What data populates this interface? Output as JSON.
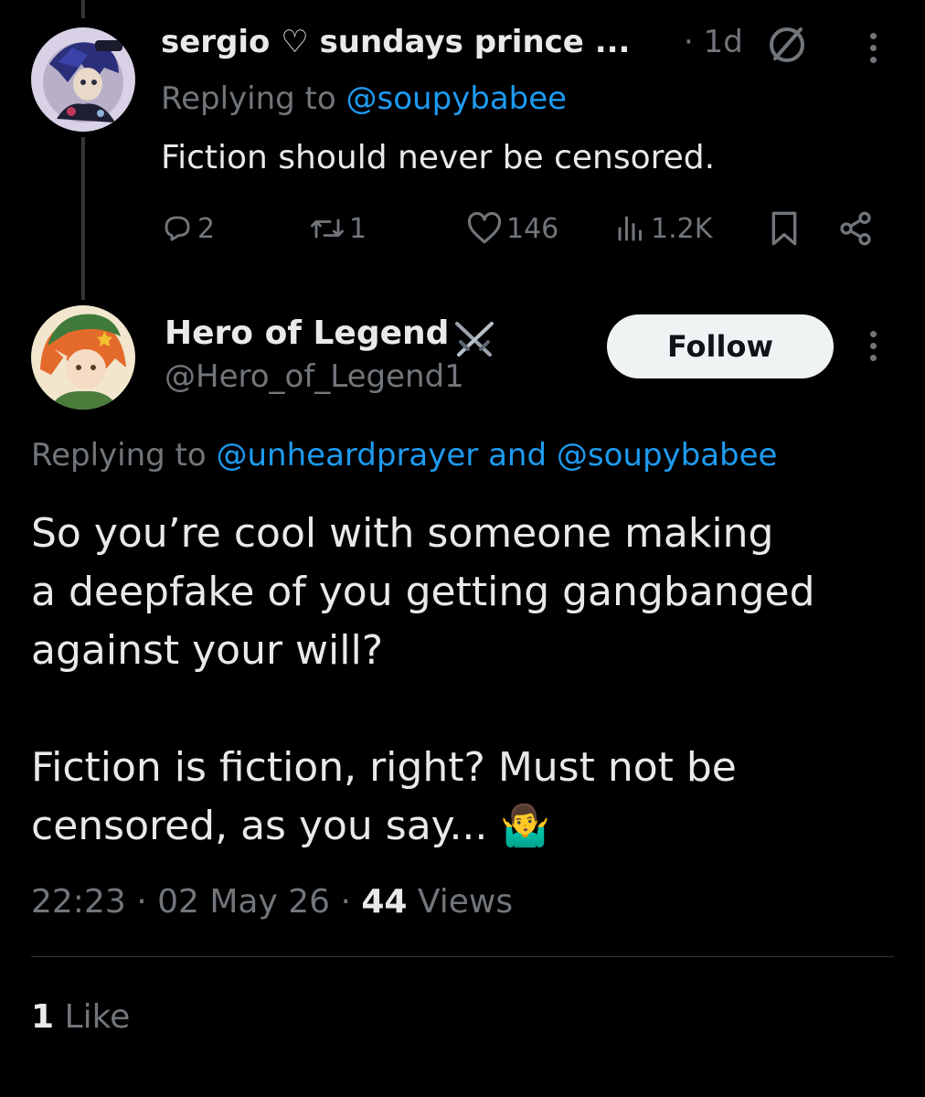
{
  "parent_tweet": {
    "display_name": "sergio ♡ sundays prince ...",
    "time": "· 1d",
    "replying_prefix": "Replying to",
    "replying_handle": "@soupybabee",
    "text": "Fiction should never be censored.",
    "stats": {
      "replies": "2",
      "reposts": "1",
      "likes": "146",
      "views": "1.2K"
    }
  },
  "main_tweet": {
    "display_name": "Hero of Legend",
    "handle": "@Hero_of_Legend1",
    "follow_label": "Follow",
    "replying_prefix": "Replying to",
    "replying_handle_1": "@unheardprayer",
    "replying_and": "and",
    "replying_handle_2": "@soupybabee",
    "text_line_1": "So you’re cool with someone making",
    "text_line_2": "a deepfake of you getting gangbanged",
    "text_line_3": "against your will?",
    "text_line_4": "Fiction is fiction, right? Must not be",
    "text_line_5": "censored, as you say... 🤷‍♂️",
    "timestamp": "22:23 · 02 May 26 ·",
    "views_count": "44",
    "views_label": "Views",
    "likes_count": "1",
    "likes_label": "Like"
  },
  "icons": {
    "no_sign": "circle-slash-icon",
    "more": "more-vertical-icon",
    "reply": "reply-icon",
    "repost": "repost-icon",
    "like": "heart-icon",
    "views": "views-bars-icon",
    "bookmark": "bookmark-icon",
    "share": "share-icon",
    "swords": "crossed-swords-icon"
  },
  "colors": {
    "background": "#000000",
    "text": "#e7e9ea",
    "muted": "#71767b",
    "link": "#1d9bf0",
    "follow_bg": "#eff3f4"
  }
}
